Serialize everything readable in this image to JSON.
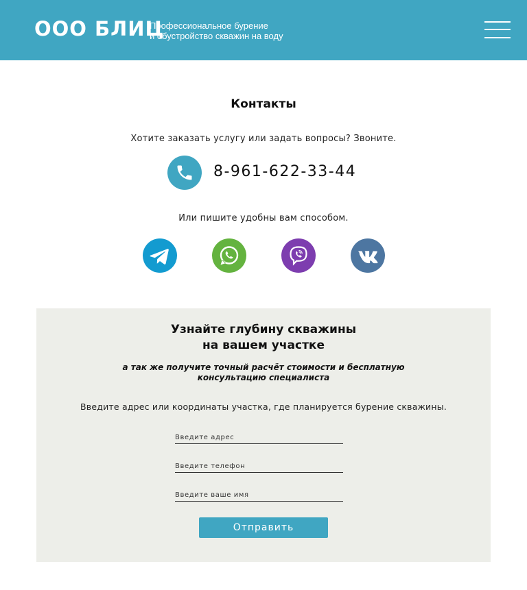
{
  "header": {
    "logo": "ООО БЛИЦ",
    "tagline_line1": "Профессиональное бурение",
    "tagline_line2": "и обустройство скважин на воду",
    "menu_icon": "burger-menu-icon",
    "background_color": "#40a6c2"
  },
  "contacts": {
    "title": "Контакты",
    "call_text": "Хотите заказать услугу или задать вопросы? Звоните.",
    "phone": "8-961-622-33-44",
    "phone_icon": "phone-icon",
    "write_text": "Или пишите удобны вам способом.",
    "messengers": [
      {
        "name": "telegram-icon",
        "color": "#139bd0"
      },
      {
        "name": "whatsapp-icon",
        "color": "#64b33f"
      },
      {
        "name": "viber-icon",
        "color": "#7d3daf"
      },
      {
        "name": "vk-icon",
        "color": "#4d76a1"
      }
    ]
  },
  "form": {
    "title_line1": "Узнайте глубину скважины",
    "title_line2": "на вашем участке",
    "subtitle_line1": "а так же получите точный расчёт стоимости и бесплатную",
    "subtitle_line2": "консультацию специалиста",
    "hint": "Введите адрес или координаты участка, где планируется бурение скважины.",
    "address_placeholder": "Введите адрес",
    "phone_placeholder": "Введите телефон",
    "name_placeholder": "Введите ваше имя",
    "submit_label": "Отправить",
    "panel_color": "#edeee9",
    "accent_color": "#40a6c2"
  }
}
